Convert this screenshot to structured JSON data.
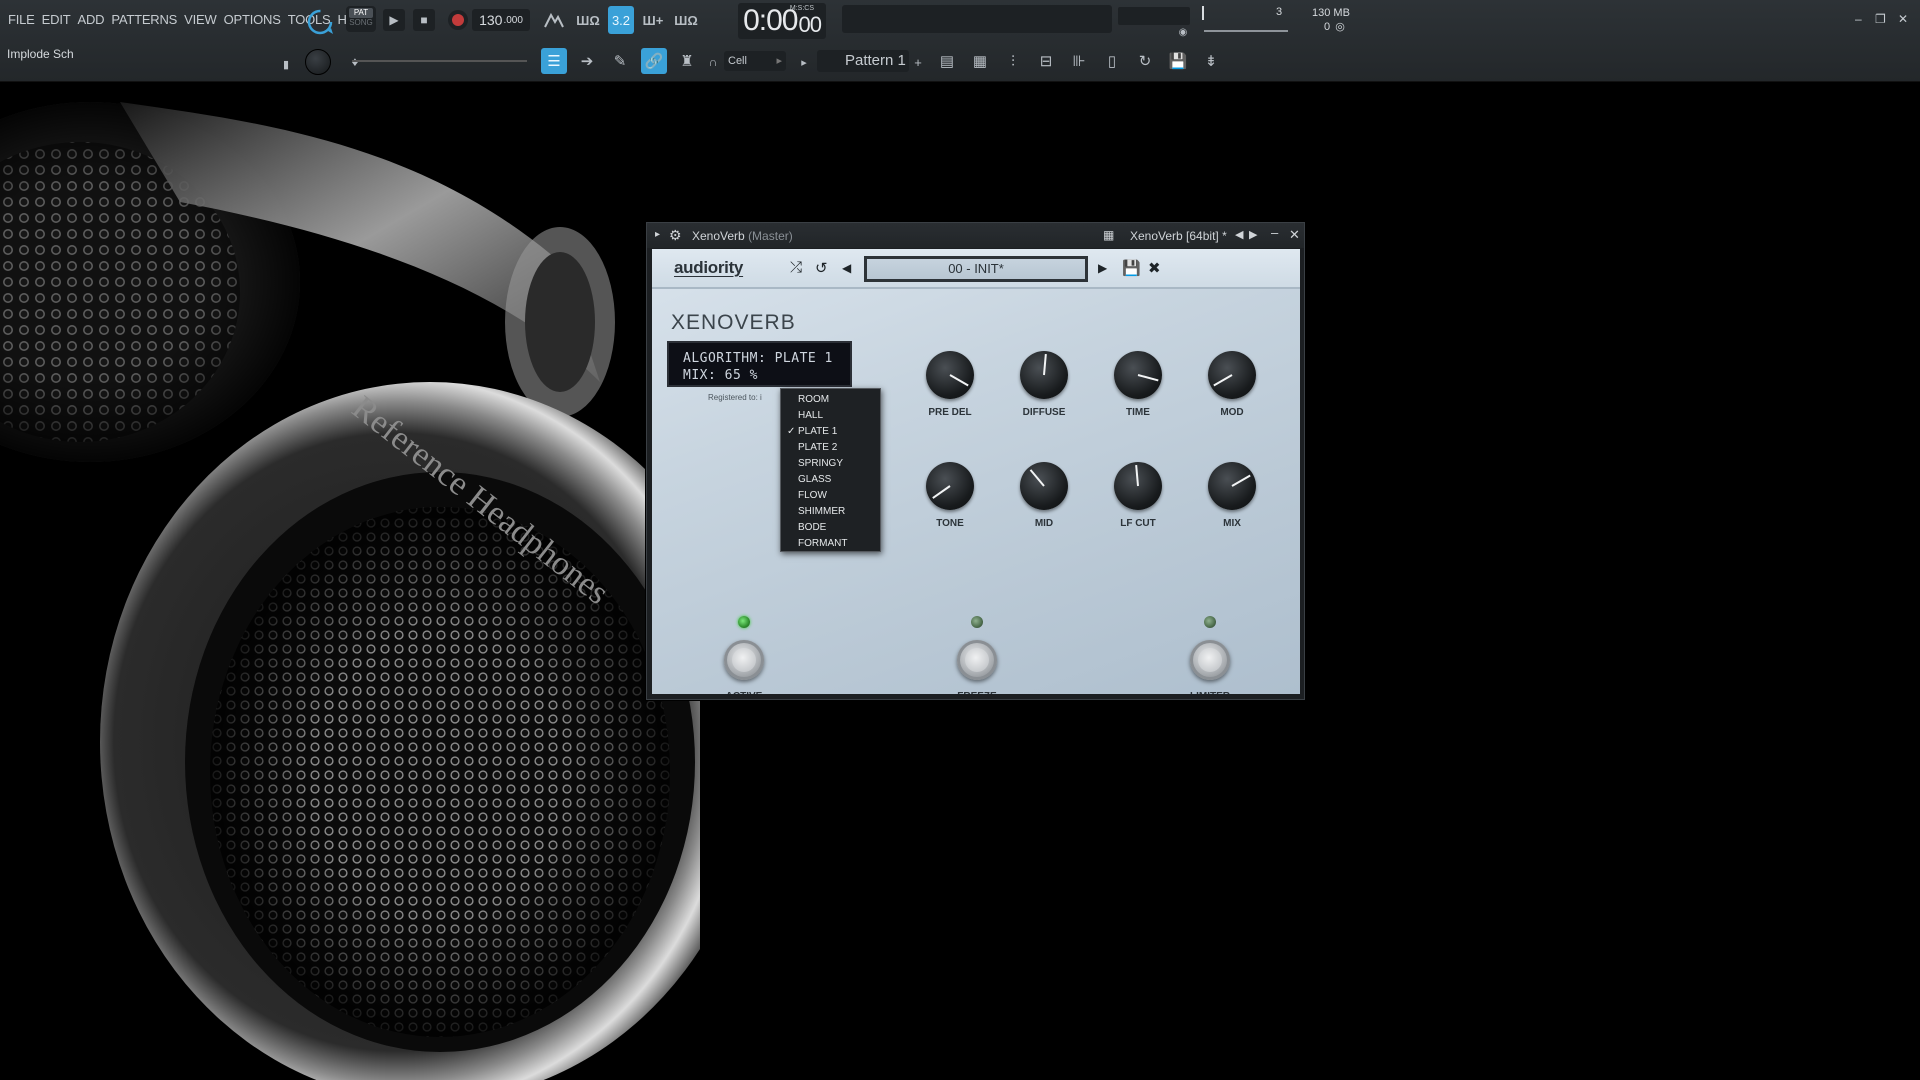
{
  "menu": [
    "FILE",
    "EDIT",
    "ADD",
    "PATTERNS",
    "VIEW",
    "OPTIONS",
    "TOOLS",
    "HELP"
  ],
  "hint_text": "Implode Sch",
  "transport": {
    "pat_label": "PAT",
    "song_label": "SONG",
    "tempo": "130",
    "tempo_decimals": ".000",
    "time_main": "0:00",
    "time_sec": "00",
    "time_format": "M:S:CS"
  },
  "status": {
    "polyphony": "3",
    "memory": "130 MB",
    "cpu_voices": "0"
  },
  "toolbar2": {
    "snap_value": "Cell",
    "pattern_name": "Pattern 1",
    "pattern_add": "+"
  },
  "plugin": {
    "title_name": "XenoVerb",
    "title_target": "(Master)",
    "title_right": "XenoVerb [64bit] *",
    "brand": "audiority",
    "preset": "00 - INIT*",
    "logo": "XENOVERB",
    "lcd_line1": "ALGORITHM: PLATE 1",
    "lcd_line2": "MIX: 65 %",
    "registered": "Registered to: i",
    "algorithms": [
      "ROOM",
      "HALL",
      "PLATE 1",
      "PLATE 2",
      "SPRINGY",
      "GLASS",
      "FLOW",
      "SHIMMER",
      "BODE",
      "FORMANT"
    ],
    "selected_algorithm": "PLATE 1",
    "knobs": [
      {
        "label": "PRE DEL",
        "angle": 120
      },
      {
        "label": "DIFFUSE",
        "angle": 5
      },
      {
        "label": "TIME",
        "angle": 105
      },
      {
        "label": "MOD",
        "angle": -120
      },
      {
        "label": "TONE",
        "angle": -125
      },
      {
        "label": "MID",
        "angle": -40
      },
      {
        "label": "LF CUT",
        "angle": -5
      },
      {
        "label": "MIX",
        "angle": 60
      }
    ],
    "switches": [
      {
        "label": "ACTIVE",
        "led_on": true
      },
      {
        "label": "FREEZE",
        "led_on": false
      },
      {
        "label": "LIMITER",
        "led_on": false
      }
    ]
  },
  "colors": {
    "accent_blue": "#3aa1d8",
    "led_green": "#2f8f2f",
    "record_red": "#c23b3b"
  }
}
